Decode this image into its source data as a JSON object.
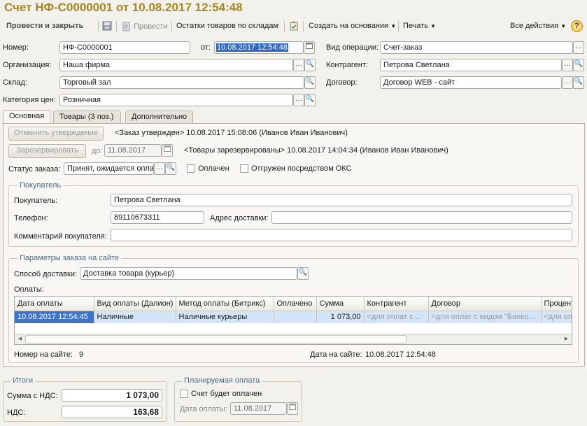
{
  "window": {
    "title": "Счет НФ-С0000001 от 10.08.2017 12:54:48"
  },
  "toolbar": {
    "post_close": "Провести и закрыть",
    "post": "Провести",
    "stock": "Остатки товаров по складам",
    "create_based": "Создать на основании",
    "print": "Печать",
    "all_actions": "Все действия",
    "help": "?"
  },
  "header": {
    "number_label": "Номер:",
    "number": "НФ-С0000001",
    "from_label": "от:",
    "date": "10.08.2017 12:54:48",
    "org_label": "Организация:",
    "org": "Наша фирма",
    "warehouse_label": "Склад:",
    "warehouse": "Торговый зал",
    "price_label": "Категория цен:",
    "price": "Розничная",
    "op_label": "Вид операции:",
    "op": "Счет-заказ",
    "contractor_label": "Контрагент:",
    "contractor": "Петрова Светлана",
    "contract_label": "Договор:",
    "contract": "Договор WEB - сайт"
  },
  "tabs": [
    {
      "label": "Основная"
    },
    {
      "label": "Товары (3 поз.)"
    },
    {
      "label": "Дополнительно"
    }
  ],
  "main": {
    "cancel_approval": "Отменить утверждение",
    "approval_info": "<Заказ утвержден> 10.08.2017 15:08:06 (Иванов Иван Иванович)",
    "reserve": "Зарезервировать",
    "till_label": "до:",
    "till_date": "11.08.2017",
    "reserve_info": "<Товары зарезервированы> 10.08.2017 14:04:34 (Иванов Иван Иванович)",
    "status_label": "Статус заказа:",
    "status": "Принят, ожидается оплата",
    "paid_label": "Оплачен",
    "shipped_label": "Отгружен посредством ОКС"
  },
  "buyer": {
    "group_title": "Покупатель",
    "buyer_label": "Покупатель:",
    "buyer": "Петрова Светлана",
    "phone_label": "Телефон:",
    "phone": "89110673311",
    "address_label": "Адрес доставки:",
    "address": "",
    "comment_label": "Комментарий покупателя:",
    "comment": ""
  },
  "site": {
    "group_title": "Параметры заказа на сайте",
    "delivery_label": "Способ доставки:",
    "delivery": "Доставка товара (курьер)",
    "payments_label": "Оплаты:",
    "columns": [
      "Дата оплаты",
      "Вид оплаты (Далион)",
      "Метод оплаты (Битрикс)",
      "Оплачено",
      "Сумма",
      "Контрагент",
      "Договор",
      "Процент"
    ],
    "rows": [
      {
        "date": "10.08.2017 12:54:45",
        "type": "Наличные",
        "method": "Наличные курьеры",
        "paid": "",
        "sum": "1 073,00",
        "contractor": "<для оплат с ...",
        "contract": "<для оплат с видом \"Банко...",
        "percent": "<для оп"
      }
    ],
    "site_number_label": "Номер на сайте:",
    "site_number": "9",
    "site_date_label": "Дата на сайте:",
    "site_date": "10.08.2017 12:54:48"
  },
  "totals": {
    "group_title": "Итоги",
    "sum_label": "Сумма с НДС:",
    "sum": "1 073,00",
    "vat_label": "НДС:",
    "vat": "163,68"
  },
  "planned": {
    "group_title": "Планируемая оплата",
    "will_pay_label": "Счет будет оплачен",
    "date_label": "Дата оплаты:",
    "date": "11.08.2017"
  }
}
